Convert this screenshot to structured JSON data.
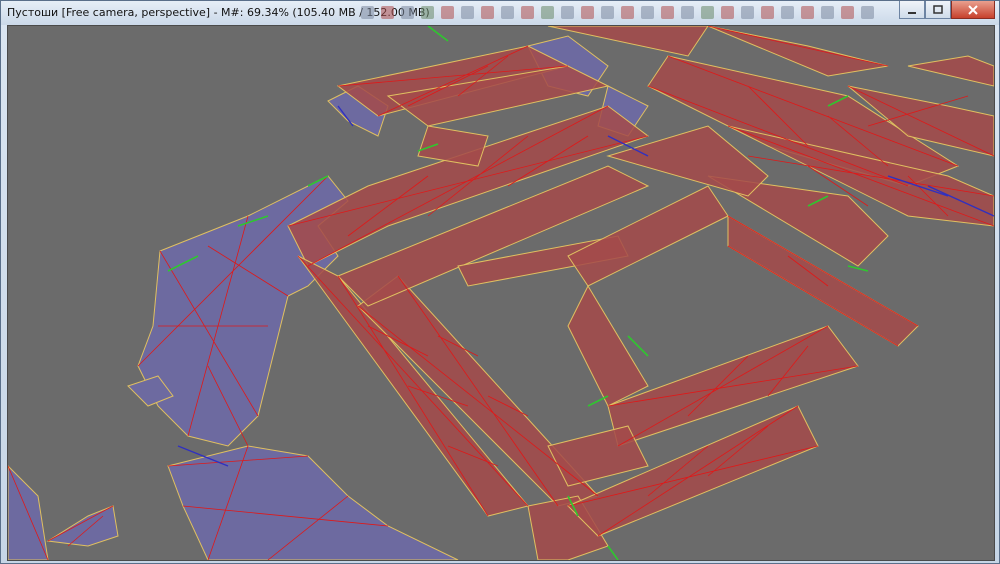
{
  "window": {
    "title": "Пустоши [Free camera, perspective] - M#: 69.34% (105.40 MB / 152.00 MB)"
  },
  "viewport": {
    "camera": "Free camera, perspective",
    "background_color": "#6b6b6b"
  },
  "colors": {
    "road_fill": "#a44a4a",
    "terrain_fill": "#6d6aa0",
    "edge_yellow": "#e0c060",
    "edge_red": "#e01818",
    "edge_green": "#2ec82e",
    "edge_blue": "#3030c0"
  },
  "icons": {
    "minimize": "minimize-icon",
    "maximize": "maximize-icon",
    "close": "close-icon"
  }
}
